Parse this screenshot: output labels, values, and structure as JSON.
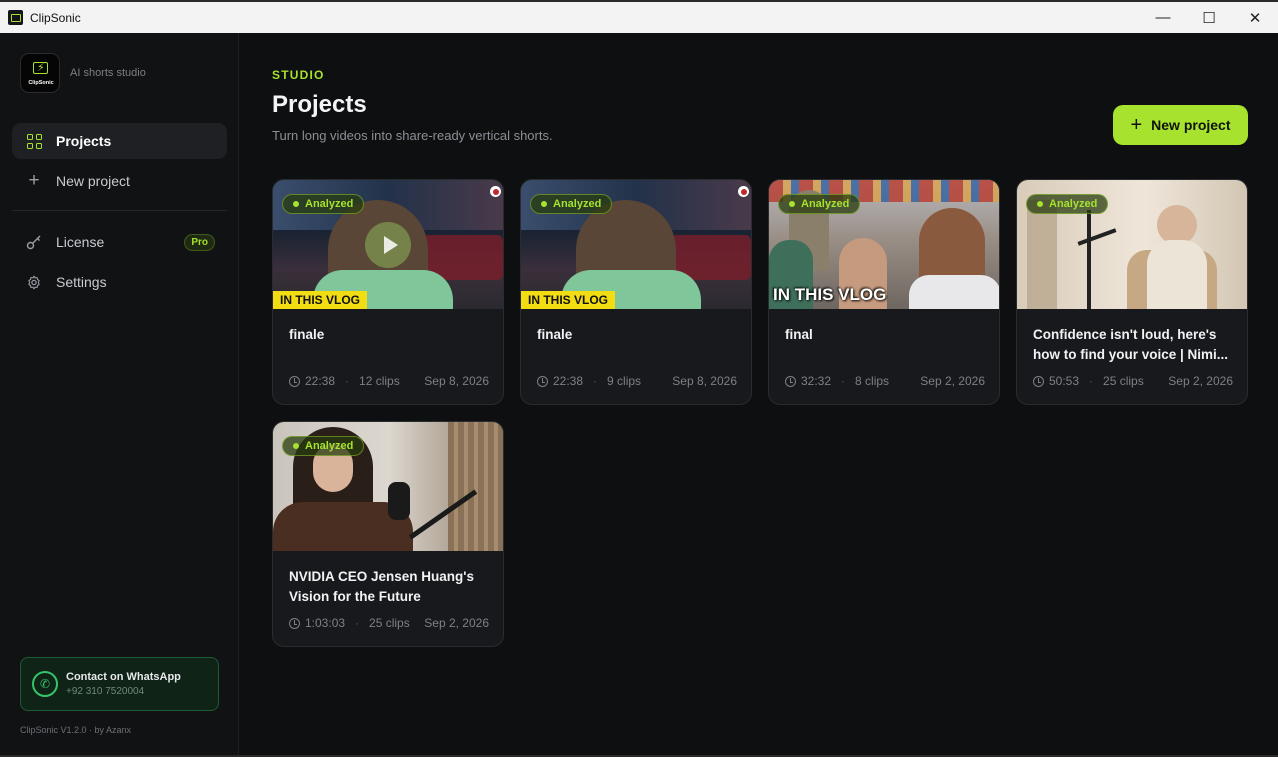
{
  "window": {
    "title": "ClipSonic",
    "controls": {
      "minimize": "—",
      "maximize": "☐",
      "close": "✕"
    }
  },
  "sidebar": {
    "brand_subtitle": "AI shorts studio",
    "logo_text": "ClipSonic",
    "nav": [
      {
        "label": "Projects",
        "icon": "grid-icon",
        "active": true
      },
      {
        "label": "New project",
        "icon": "plus-icon",
        "active": false
      },
      {
        "label": "License",
        "icon": "key-icon",
        "badge": "Pro"
      },
      {
        "label": "Settings",
        "icon": "gear-icon"
      }
    ],
    "whatsapp": {
      "title": "Contact on WhatsApp",
      "phone": "+92 310 7520004"
    },
    "version": "ClipSonic V1.2.0 · by Azanx"
  },
  "header": {
    "eyebrow": "STUDIO",
    "title": "Projects",
    "subtitle": "Turn long videos into share-ready vertical shorts.",
    "new_project_label": "New project"
  },
  "projects": [
    {
      "title": "finale",
      "duration": "22:38",
      "clips": "12 clips",
      "date": "Sep 8, 2026",
      "status": "Analyzed",
      "overlay": "IN THIS VLOG"
    },
    {
      "title": "finale",
      "duration": "22:38",
      "clips": "9 clips",
      "date": "Sep 8, 2026",
      "status": "Analyzed",
      "overlay": "IN THIS VLOG"
    },
    {
      "title": "final",
      "duration": "32:32",
      "clips": "8 clips",
      "date": "Sep 2, 2026",
      "status": "Analyzed",
      "overlay": "IN THIS VLOG"
    },
    {
      "title": "Confidence isn't loud, here's how to find your voice | Nimi...",
      "duration": "50:53",
      "clips": "25 clips",
      "date": "Sep 2, 2026",
      "status": "Analyzed"
    },
    {
      "title": "NVIDIA CEO Jensen Huang's Vision for the Future",
      "duration": "1:03:03",
      "clips": "25 clips",
      "date": "Sep 2, 2026",
      "status": "Analyzed"
    }
  ],
  "colors": {
    "accent": "#a6e22e",
    "background": "#0e0f11",
    "card": "#18191c",
    "whatsapp": "#34c46a"
  }
}
